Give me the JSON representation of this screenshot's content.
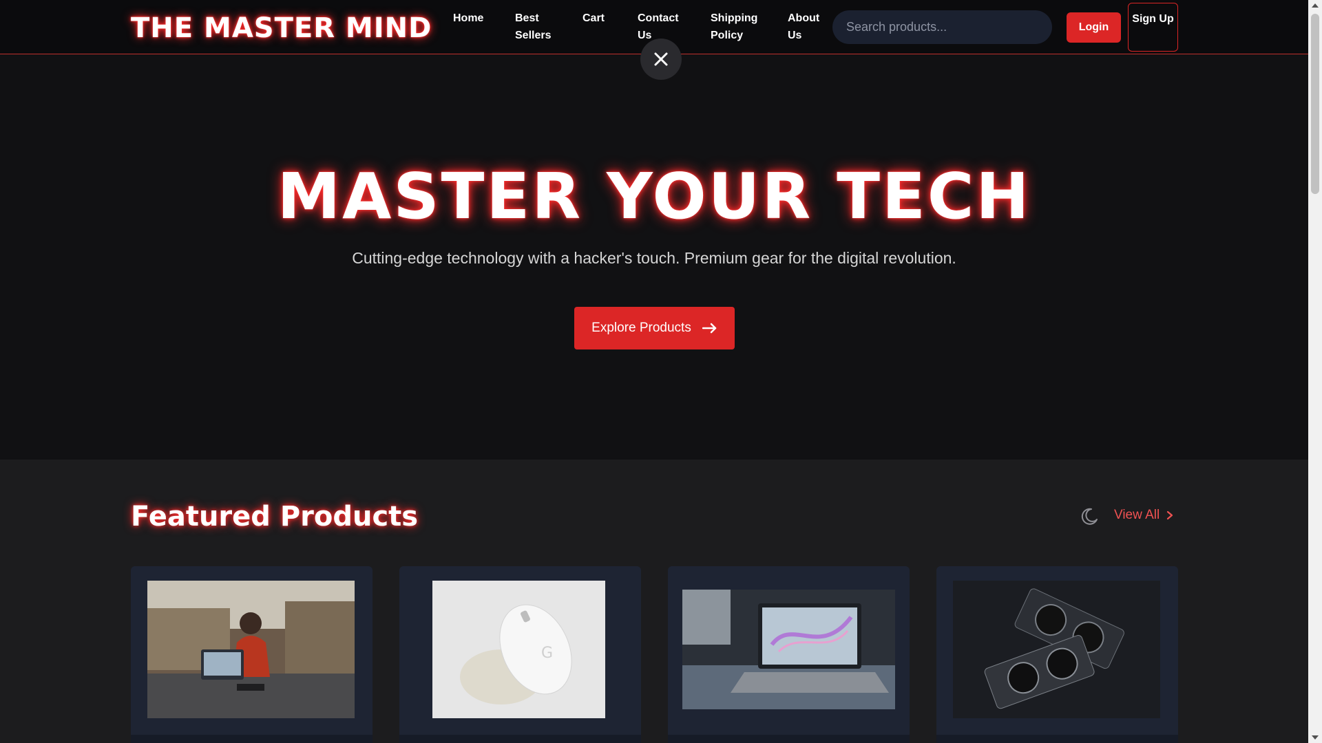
{
  "header": {
    "logo": "THE MASTER MIND",
    "nav": [
      "Home",
      "Best Sellers",
      "Cart",
      "Contact Us",
      "Shipping Policy",
      "About Us"
    ],
    "search_placeholder": "Search products...",
    "login_label": "Login",
    "signup_label": "Sign Up"
  },
  "hero": {
    "title": "MASTER YOUR TECH",
    "subtitle": "Cutting-edge technology with a hacker's touch. Premium gear for the digital revolution.",
    "cta_label": "Explore Products"
  },
  "featured": {
    "title": "Featured Products",
    "view_all_label": "View All"
  },
  "colors": {
    "accent": "#dc2626",
    "background": "#111113",
    "card": "#1e2433",
    "glow": "#ff2b2b"
  },
  "icons": [
    "close-icon",
    "arrow-right-icon",
    "moon-icon",
    "chevron-right-icon"
  ]
}
